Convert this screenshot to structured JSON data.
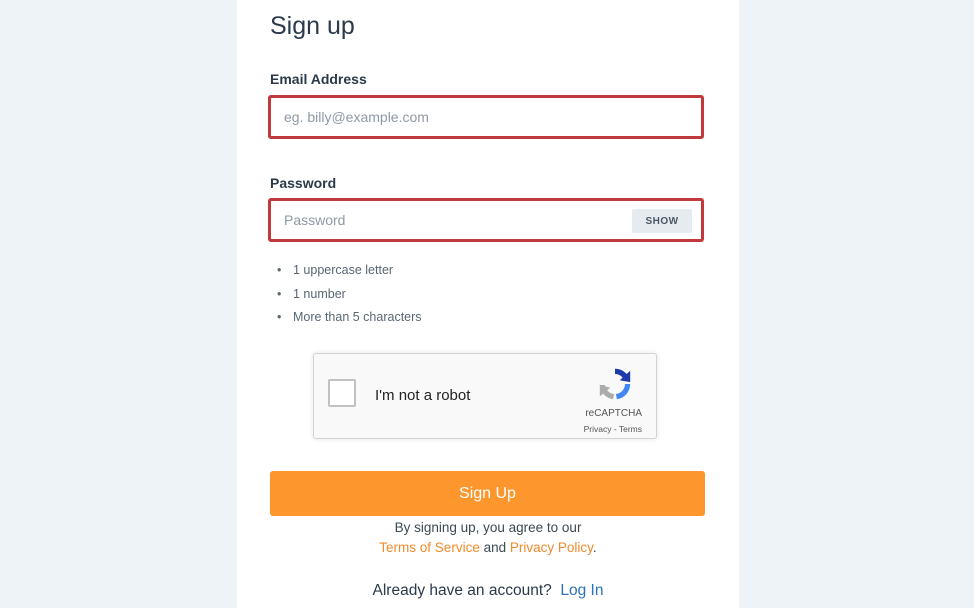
{
  "form": {
    "title": "Sign up",
    "email": {
      "label": "Email Address",
      "value": "",
      "placeholder": "eg. billy@example.com"
    },
    "password": {
      "label": "Password",
      "value": "",
      "placeholder": "Password",
      "show_label": "SHOW"
    },
    "rules": [
      "1 uppercase letter",
      "1 number",
      "More than 5 characters"
    ],
    "recaptcha": {
      "label": "I'm not a robot",
      "brand": "reCAPTCHA",
      "privacy": "Privacy",
      "separator": " - ",
      "terms": "Terms",
      "checked": false
    },
    "submit_label": "Sign Up",
    "agreement": {
      "prefix": "By signing up, you agree to our",
      "terms_link": "Terms of Service",
      "and": "and",
      "privacy_link": "Privacy Policy",
      "suffix": "."
    },
    "login": {
      "prompt": "Already have an account?",
      "link": "Log In"
    }
  },
  "colors": {
    "page_background": "#eef3f8",
    "error_border": "#c0393b",
    "primary_button": "#fc962d",
    "link_orange": "#f08a2b",
    "link_blue": "#2b72b8"
  }
}
